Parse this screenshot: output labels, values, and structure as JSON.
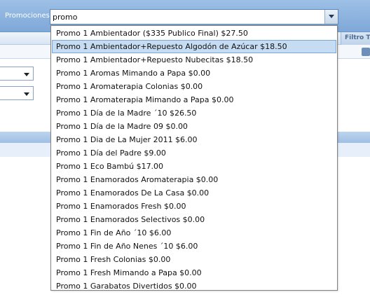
{
  "header": {
    "label": "Promociones",
    "input_value": "promo",
    "filter_column": "Filtro Ti"
  },
  "dropdown": {
    "selected_index": 1,
    "items": [
      "Promo 1 Ambientador ($335 Publico Final) $27.50",
      "Promo 1 Ambientador+Repuesto Algodón de Azúcar $18.50",
      "Promo 1 Ambientador+Repuesto Nubecitas $18.50",
      "Promo 1 Aromas Mimando a Papa $0.00",
      "Promo 1 Aromaterapia Colonias $0.00",
      "Promo 1 Aromaterapia Mimando a Papa $0.00",
      "Promo 1 Día de la Madre ´10 $26.50",
      "Promo 1 Día de la Madre 09 $0.00",
      "Promo 1 Dia de La Mujer 2011 $6.00",
      "Promo 1 Día del Padre $9.00",
      "Promo 1 Eco Bambú $17.00",
      "Promo 1 Enamorados Aromaterapia $0.00",
      "Promo 1 Enamorados De La Casa $0.00",
      "Promo 1 Enamorados Fresh $0.00",
      "Promo 1 Enamorados Selectivos $0.00",
      "Promo 1 Fin de Año ´10 $6.00",
      "Promo 1 Fin de Año Nenes ´10 $6.00",
      "Promo 1 Fresh Colonias $0.00",
      "Promo 1 Fresh Mimando a Papa $0.00",
      "Promo 1 Garabatos Divertidos $0.00"
    ]
  },
  "colors": {
    "header_blue": "#8fb4df",
    "selection_fill": "#c5dcf3",
    "selection_border": "#7aa7d9"
  }
}
